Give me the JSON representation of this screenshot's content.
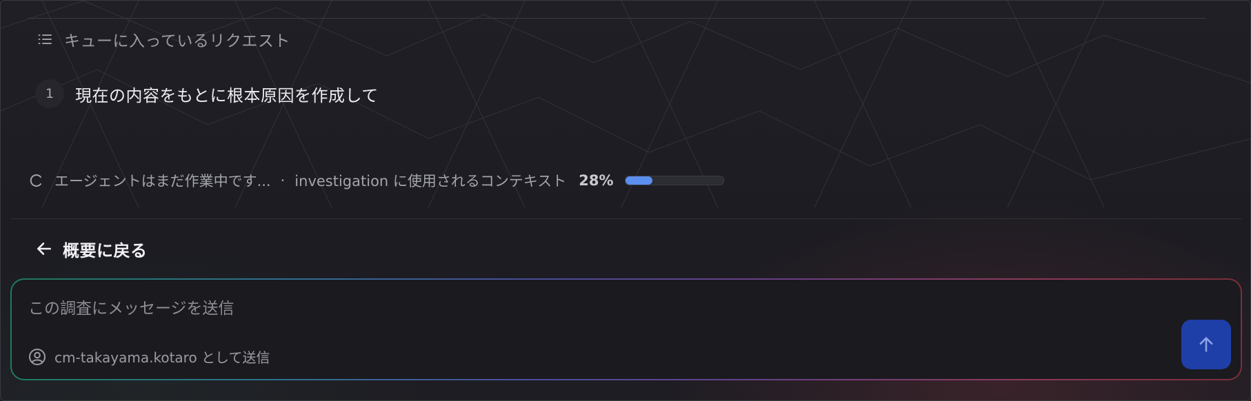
{
  "queue": {
    "title": "キューに入っているリクエスト",
    "items": [
      {
        "number": "1",
        "text": "現在の内容をもとに根本原因を作成して"
      }
    ]
  },
  "status": {
    "working_text": "エージェントはまだ作業中です...",
    "separator": "·",
    "context_text": "investigation に使用されるコンテキスト",
    "context_percent_label": "28%",
    "context_percent": 28
  },
  "nav": {
    "back_label": "概要に戻る"
  },
  "composer": {
    "placeholder": "この調査にメッセージを送信",
    "sender_text": "cm-takayama.kotaro として送信"
  },
  "icons": {
    "queue": "list-icon",
    "status": "spinner-icon",
    "back": "arrow-left-icon",
    "sender": "user-circle-icon",
    "send": "arrow-up-icon"
  },
  "colors": {
    "accent": "#5b8ff0",
    "send_button": "#1f3fa8",
    "background": "#1b1b21"
  }
}
